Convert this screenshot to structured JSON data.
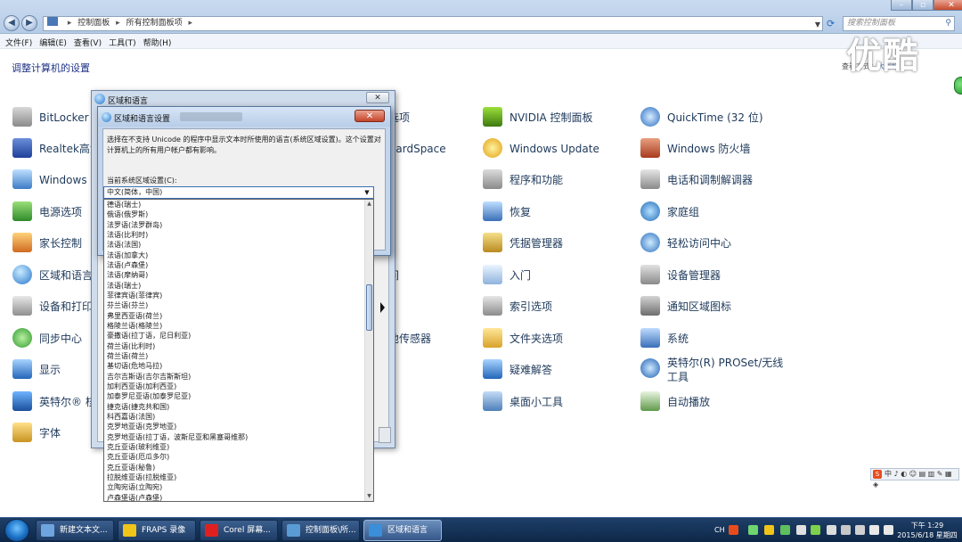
{
  "window": {
    "breadcrumb": [
      "控制面板",
      "所有控制面板项"
    ],
    "search_placeholder": "搜索控制面板"
  },
  "menu": [
    "文件(F)",
    "编辑(E)",
    "查看(V)",
    "工具(T)",
    "帮助(H)"
  ],
  "page": {
    "title": "调整计算机的设置",
    "view_by_label": "查看方式：",
    "view_by_value": "大图标"
  },
  "watermark": "优酷",
  "items": [
    {
      "label": "BitLocker 驱",
      "icon": "bitlocker-icon"
    },
    {
      "label": "Realtek高清",
      "icon": "realtek-audio-icon"
    },
    {
      "label": "Windows 移",
      "icon": "windows-mobility-icon"
    },
    {
      "label": "电源选项",
      "icon": "power-options-icon"
    },
    {
      "label": "家长控制",
      "icon": "parental-controls-icon"
    },
    {
      "label": "区域和语言",
      "icon": "region-language-icon"
    },
    {
      "label": "设备和打印",
      "icon": "devices-printers-icon"
    },
    {
      "label": "同步中心",
      "icon": "sync-center-icon"
    },
    {
      "label": "显示",
      "icon": "display-icon"
    },
    {
      "label": "英特尔® 核",
      "icon": "intel-graphics-icon"
    },
    {
      "label": "字体",
      "icon": "fonts-icon"
    },
    {
      "label": "选项",
      "icon": ""
    },
    {
      "label": "CardSpace",
      "icon": ""
    },
    {
      "label": "间",
      "icon": ""
    },
    {
      "label": "他传感器",
      "icon": ""
    },
    {
      "label": "NVIDIA 控制面板",
      "icon": "nvidia-icon"
    },
    {
      "label": "Windows Update",
      "icon": "windows-update-icon"
    },
    {
      "label": "程序和功能",
      "icon": "programs-features-icon"
    },
    {
      "label": "恢复",
      "icon": "recovery-icon"
    },
    {
      "label": "凭据管理器",
      "icon": "credential-manager-icon"
    },
    {
      "label": "入门",
      "icon": "getting-started-icon"
    },
    {
      "label": "索引选项",
      "icon": "indexing-options-icon"
    },
    {
      "label": "文件夹选项",
      "icon": "folder-options-icon"
    },
    {
      "label": "疑难解答",
      "icon": "troubleshooting-icon"
    },
    {
      "label": "桌面小工具",
      "icon": "desktop-gadgets-icon"
    },
    {
      "label": "QuickTime (32 位)",
      "icon": "quicktime-icon"
    },
    {
      "label": "Windows 防火墙",
      "icon": "firewall-icon"
    },
    {
      "label": "电话和调制解调器",
      "icon": "phone-modem-icon"
    },
    {
      "label": "家庭组",
      "icon": "homegroup-icon"
    },
    {
      "label": "轻松访问中心",
      "icon": "ease-of-access-icon"
    },
    {
      "label": "设备管理器",
      "icon": "device-manager-icon"
    },
    {
      "label": "通知区域图标",
      "icon": "notification-area-icon"
    },
    {
      "label": "系统",
      "icon": "system-icon"
    },
    {
      "label": "英特尔(R) PROSet/无线工具",
      "icon": "intel-proset-icon"
    },
    {
      "label": "自动播放",
      "icon": "autoplay-icon"
    }
  ],
  "dialog_outer": {
    "title": "区域和语言",
    "close": "✕"
  },
  "dialog_inner": {
    "title": "区域和语言设置",
    "close": "✕",
    "description": "选择在不支持 Unicode 的程序中显示文本时所使用的语言(系统区域设置)。这个设置对计算机上的所有用户帐户都有影响。",
    "locale_label": "当前系统区域设置(C):",
    "selected_locale": "中文(简体，中国)"
  },
  "locale_options": [
    "德语(瑞士)",
    "俄语(俄罗斯)",
    "法罗语(法罗群岛)",
    "法语(比利时)",
    "法语(法国)",
    "法语(加拿大)",
    "法语(卢森堡)",
    "法语(摩纳哥)",
    "法语(瑞士)",
    "菲律宾语(菲律宾)",
    "芬兰语(芬兰)",
    "弗里西亚语(荷兰)",
    "格陵兰语(格陵兰)",
    "豪撒语(拉丁语，尼日利亚)",
    "荷兰语(比利时)",
    "荷兰语(荷兰)",
    "基切语(危地马拉)",
    "吉尔吉斯语(吉尔吉斯斯坦)",
    "加利西亚语(加利西亚)",
    "加泰罗尼亚语(加泰罗尼亚)",
    "捷克语(捷克共和国)",
    "科西嘉语(法国)",
    "克罗地亚语(克罗地亚)",
    "克罗地亚语(拉丁语，波斯尼亚和黑塞哥维那)",
    "克丘亚语(玻利维亚)",
    "克丘亚语(厄瓜多尔)",
    "克丘亚语(秘鲁)",
    "拉脱维亚语(拉脱维亚)",
    "立陶宛语(立陶宛)",
    "卢森堡语(卢森堡)"
  ],
  "ime_bar": {
    "brand": "S",
    "text": "中 ♪ ◐ ☺ ▤ ▥ ✎ ▦ ◈"
  },
  "taskbar": {
    "tasks": [
      {
        "label": "新建文本文...",
        "color": "#6fa5de"
      },
      {
        "label": "FRAPS 录像",
        "color": "#f0c419"
      },
      {
        "label": "Corel 屏幕...",
        "color": "#e02020"
      },
      {
        "label": "控制面板\\所...",
        "color": "#5b9bd5"
      },
      {
        "label": "区域和语言",
        "color": "#3b8ed8"
      }
    ],
    "ime": "CH",
    "time": "下午 1:29",
    "date": "2015/6/18 星期四"
  }
}
